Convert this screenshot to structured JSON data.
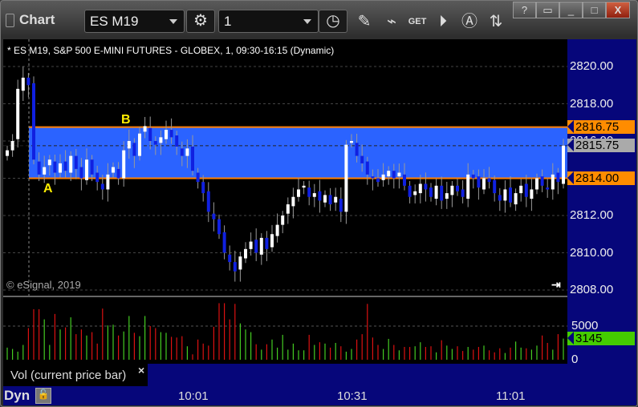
{
  "window": {
    "title": "Chart",
    "symbol": "ES M19",
    "interval": "1",
    "buttons": [
      "?",
      "restore-menu",
      "minimize",
      "maximize",
      "close"
    ]
  },
  "toolbar": {
    "icons": [
      "settings-icon",
      "clock-icon",
      "pencil-icon",
      "studies-icon",
      "get-icon",
      "play-icon",
      "alert-icon",
      "link-icon"
    ]
  },
  "chart": {
    "header": "* ES M19, S&P 500 E-MINI FUTURES - GLOBEX, 1, 09:30-16:15 (Dynamic)",
    "copyright": "© eSignal, 2019",
    "price_labels": [
      "2820.00",
      "2818.00",
      "2816.00",
      "2814.00",
      "2812.00",
      "2810.00",
      "2808.00"
    ],
    "price_values": [
      2820,
      2818,
      2816,
      2814,
      2812,
      2810,
      2808
    ],
    "tags": {
      "upper": "2816.75",
      "current": "2815.75",
      "lower": "2814.00"
    },
    "band": {
      "upper": 2816.75,
      "lower": 2814.0,
      "color": "#2b63ff",
      "line_color": "#ff8000"
    },
    "annotations": {
      "a": "A",
      "b": "B"
    },
    "colors": {
      "up": "#ffffff",
      "down": "#1020e0",
      "vol_up": "#44cc22",
      "vol_down": "#dd1111",
      "bg": "#000000",
      "axis": "#06067a"
    },
    "time_labels": [
      "10:01",
      "10:31",
      "11:01"
    ]
  },
  "chart_data": {
    "type": "candlestick",
    "closes": [
      2815.5,
      2816.0,
      2818.8,
      2819.4,
      2819.0,
      2815.0,
      2814.2,
      2814.6,
      2815.0,
      2814.3,
      2814.8,
      2814.4,
      2815.2,
      2814.5,
      2814.0,
      2815.0,
      2814.2,
      2813.8,
      2813.4,
      2814.2,
      2814.6,
      2814.0,
      2815.5,
      2816.0,
      2815.2,
      2816.4,
      2816.8,
      2816.0,
      2815.8,
      2816.2,
      2816.6,
      2816.2,
      2815.7,
      2815.2,
      2815.6,
      2814.4,
      2813.8,
      2813.2,
      2812.2,
      2811.8,
      2811.0,
      2810.0,
      2809.5,
      2809.0,
      2809.8,
      2810.2,
      2810.6,
      2810.0,
      2810.8,
      2810.2,
      2811.0,
      2811.5,
      2812.0,
      2812.6,
      2813.0,
      2813.4,
      2813.6,
      2813.0,
      2813.2,
      2812.8,
      2813.1,
      2812.6,
      2813.0,
      2812.2,
      2815.8,
      2816.0,
      2815.2,
      2814.8,
      2814.2,
      2814.0,
      2813.8,
      2814.2,
      2814.4,
      2814.0,
      2814.3,
      2813.6,
      2813.0,
      2813.3,
      2813.7,
      2813.4,
      2813.0,
      2813.6,
      2812.8,
      2813.2,
      2813.6,
      2813.3,
      2813.0,
      2814.2,
      2814.0,
      2813.5,
      2814.0,
      2813.8,
      2813.2,
      2812.8,
      2813.4,
      2812.7,
      2813.2,
      2813.6,
      2813.0,
      2813.4,
      2814.0,
      2813.6,
      2813.4,
      2814.2,
      2813.8,
      2815.75
    ],
    "volumes": [
      1800,
      1600,
      1200,
      2200,
      4700,
      7500,
      7500,
      6000,
      2200,
      6800,
      4500,
      4800,
      6300,
      3800,
      4500,
      3600,
      4100,
      2400,
      7600,
      5100,
      5200,
      3600,
      4200,
      6500,
      4000,
      3500,
      6500,
      5000,
      4700,
      4100,
      4000,
      3400,
      3300,
      3500,
      2000,
      800,
      3000,
      2400,
      2100,
      4900,
      8400,
      8400,
      6000,
      8300,
      5400,
      4500,
      4100,
      2300,
      1500,
      2300,
      3000,
      1800,
      3700,
      1500,
      2400,
      1400,
      1400,
      3700,
      2200,
      2600,
      2400,
      1800,
      2500,
      2000,
      1200,
      1600,
      3000,
      3800,
      8300,
      3300,
      2200,
      1600,
      3100,
      2200,
      1400,
      1900,
      1900,
      2000,
      2600,
      1900,
      2000,
      1100,
      2900,
      2100,
      1600,
      2000,
      1300,
      1900,
      1500,
      1900,
      2100,
      1400,
      1100,
      1700,
      1000,
      1800,
      2700,
      1800,
      1700,
      1500,
      2100,
      3600,
      2500,
      1500,
      3800,
      3145
    ],
    "ylim": [
      2808,
      2821
    ],
    "vol_ticks": [
      0,
      5000
    ],
    "vol_current": 3145
  },
  "volume_panel": {
    "ticks": [
      "5000",
      "0"
    ],
    "current": "3145",
    "label": "Vol (current price bar)",
    "close": "×"
  },
  "footer": {
    "mode": "Dyn"
  }
}
